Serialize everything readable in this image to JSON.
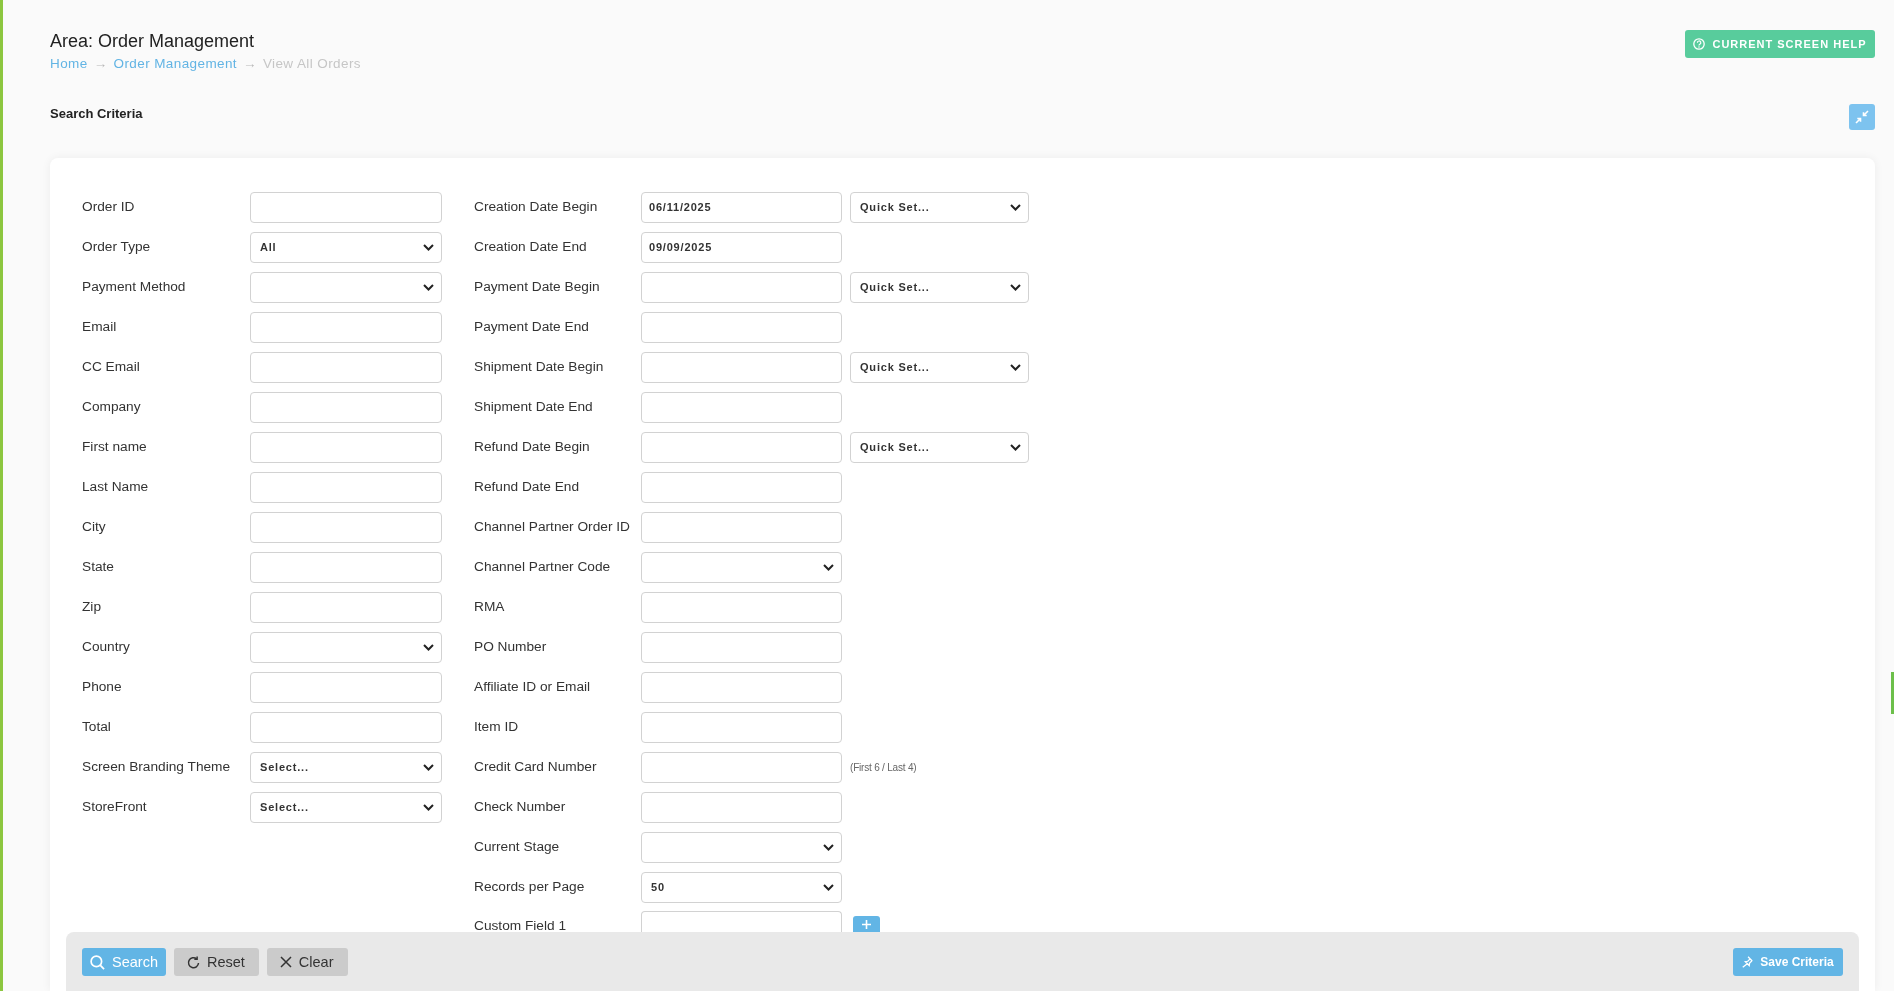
{
  "header": {
    "title": "Area: Order Management",
    "breadcrumb": [
      {
        "kind": "link",
        "label": "Home"
      },
      {
        "kind": "separator",
        "label": "→"
      },
      {
        "kind": "link",
        "label": "Order Management"
      },
      {
        "kind": "separator",
        "label": "→"
      },
      {
        "kind": "current",
        "label": "View All Orders"
      }
    ],
    "help_button": "CURRENT SCREEN HELP"
  },
  "search_criteria": {
    "title": "Search Criteria",
    "columns": [
      {
        "fields": [
          {
            "label": "Order ID",
            "kind": "text"
          },
          {
            "label": "Order Type",
            "kind": "select",
            "value": "All"
          },
          {
            "label": "Payment Method",
            "kind": "select"
          },
          {
            "label": "Email",
            "kind": "text"
          },
          {
            "label": "CC Email",
            "kind": "text"
          },
          {
            "label": "Company",
            "kind": "text"
          },
          {
            "label": "First name",
            "kind": "text"
          },
          {
            "label": "Last Name",
            "kind": "text"
          },
          {
            "label": "City",
            "kind": "text"
          },
          {
            "label": "State",
            "kind": "text"
          },
          {
            "label": "Zip",
            "kind": "text"
          },
          {
            "label": "Country",
            "kind": "select"
          },
          {
            "label": "Phone",
            "kind": "text"
          },
          {
            "label": "Total",
            "kind": "text"
          },
          {
            "label": "Screen Branding Theme",
            "kind": "select",
            "value": "Select..."
          },
          {
            "label": "StoreFront",
            "kind": "select",
            "value": "Select..."
          }
        ]
      },
      {
        "fields": [
          {
            "label": "Creation Date Begin",
            "kind": "text",
            "value": "06/11/2025",
            "quick_set": "Quick Set..."
          },
          {
            "label": "Creation Date End",
            "kind": "text",
            "value": "09/09/2025"
          },
          {
            "label": "Payment Date Begin",
            "kind": "text",
            "quick_set": "Quick Set..."
          },
          {
            "label": "Payment Date End",
            "kind": "text"
          },
          {
            "label": "Shipment Date Begin",
            "kind": "text",
            "quick_set": "Quick Set..."
          },
          {
            "label": "Shipment Date End",
            "kind": "text"
          },
          {
            "label": "Refund Date Begin",
            "kind": "text",
            "quick_set": "Quick Set..."
          },
          {
            "label": "Refund Date End",
            "kind": "text"
          },
          {
            "label": "Channel Partner Order ID",
            "kind": "text"
          },
          {
            "label": "Channel Partner Code",
            "kind": "select"
          },
          {
            "label": "RMA",
            "kind": "text"
          },
          {
            "label": "PO Number",
            "kind": "text"
          },
          {
            "label": "Affiliate ID or Email",
            "kind": "text"
          },
          {
            "label": "Item ID",
            "kind": "text"
          },
          {
            "label": "Credit Card Number",
            "kind": "text",
            "hint": "(First 6 / Last 4)"
          },
          {
            "label": "Check Number",
            "kind": "text"
          },
          {
            "label": "Current Stage",
            "kind": "select"
          },
          {
            "label": "Records per Page",
            "kind": "select",
            "value": "50"
          },
          {
            "label": "Custom Field 1",
            "kind": "text",
            "addable": true
          }
        ]
      }
    ]
  },
  "footer": {
    "buttons": [
      {
        "kind": "search",
        "label": "Search"
      },
      {
        "kind": "reset",
        "label": "Reset"
      },
      {
        "kind": "clear",
        "label": "Clear"
      }
    ],
    "save_button": "Save Criteria"
  }
}
